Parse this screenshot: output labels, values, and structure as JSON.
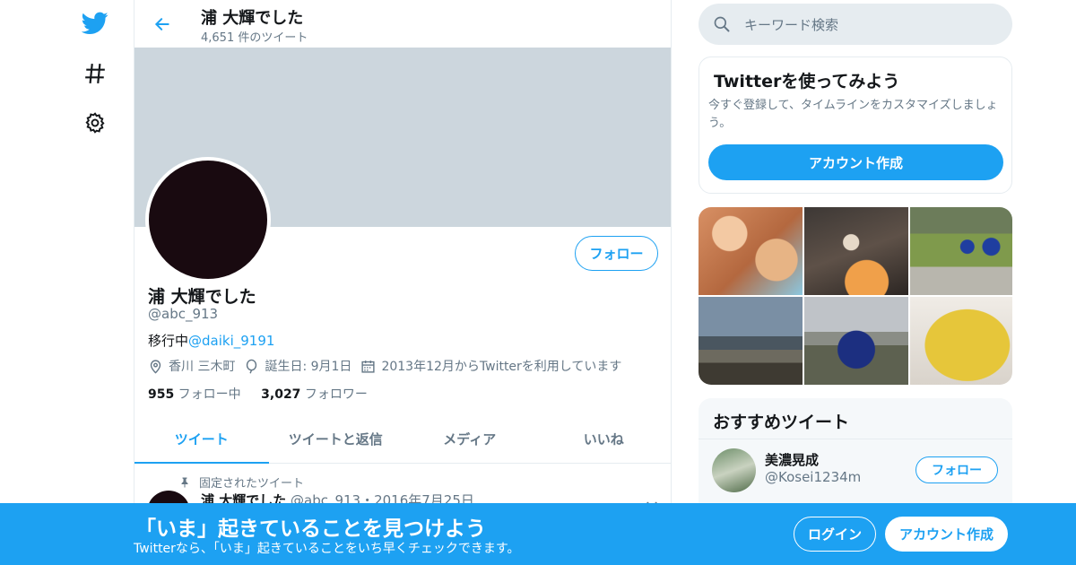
{
  "nav": {
    "items": [
      "twitter-logo",
      "hashtag-icon",
      "gear-icon"
    ]
  },
  "header": {
    "title": "浦 大輝でした",
    "tweet_count": "4,651 件のツイート"
  },
  "profile": {
    "name": "浦 大輝でした",
    "handle": "@abc_913",
    "bio_prefix": "移行中",
    "bio_link": "@daiki_9191",
    "location": "香川 三木町",
    "birthday": "誕生日: 9月1日",
    "joined": "2013年12月からTwitterを利用しています",
    "following_count": "955",
    "following_label": " フォロー中",
    "followers_count": "3,027",
    "followers_label": " フォロワー",
    "follow_label": "フォロー"
  },
  "tabs": [
    "ツイート",
    "ツイートと返信",
    "メディア",
    "いいね"
  ],
  "active_tab": "ツイート",
  "pinned_tweet": {
    "label": "固定されたツイート",
    "name": "浦 大輝でした",
    "meta": " @abc_913・2016年7月25日"
  },
  "search": {
    "placeholder": "キーワード検索"
  },
  "signup_card": {
    "title": "Twitterを使ってみよう",
    "text": "今すぐ登録して、タイムラインをカスタマイズしましょう。",
    "button": "アカウント作成"
  },
  "recommended": {
    "title": "おすすめツイート",
    "user_name": "美濃晃成",
    "user_handle": "@Kosei1234m",
    "follow_label": "フォロー"
  },
  "bottom_bar": {
    "title": "「いま」起きていることを見つけよう",
    "subtitle": "Twitterなら、「いま」起きていることをいち早くチェックできます。",
    "login": "ログイン",
    "signup": "アカウント作成"
  },
  "colors": {
    "accent": "#1da1f2",
    "banner": "#ccd6dd",
    "muted_text": "#657786"
  }
}
